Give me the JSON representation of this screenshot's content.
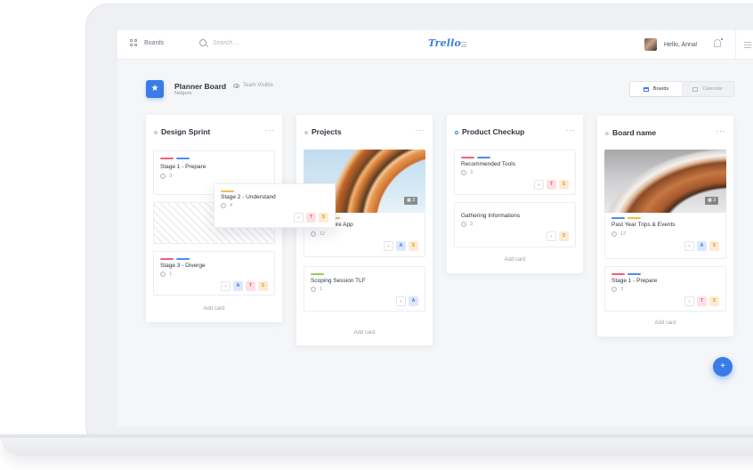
{
  "topbar": {
    "boards_label": "Boards",
    "search_placeholder": "Search ...",
    "logo": "Trello",
    "greeting": "Hello, Anna!"
  },
  "board": {
    "title": "Planner Board",
    "subtitle": "Netguru",
    "visibility": "Team Visible"
  },
  "view_toggle": {
    "boards": "Boards",
    "calendar": "Calendar"
  },
  "lists": [
    {
      "title": "Design Sprint",
      "cards": [
        {
          "title": "Stage 1 - Prepare",
          "count": "3"
        },
        {
          "title": "Stage 3 - Diverge",
          "count": "1",
          "members": [
            "+",
            "A",
            "T",
            "S"
          ]
        }
      ],
      "add_card": "Add card"
    },
    {
      "title": "Projects",
      "cards": [
        {
          "title": "Architecture App",
          "count": "12",
          "image_count": "3",
          "members": [
            "+",
            "A",
            "S"
          ]
        },
        {
          "title": "Scoping Session TLF",
          "count": "1",
          "members": [
            "+",
            "A"
          ]
        }
      ],
      "add_card": "Add card"
    },
    {
      "title": "Product Checkup",
      "cards": [
        {
          "title": "Recommended Tools",
          "count": "3",
          "members": [
            "+",
            "T",
            "S"
          ]
        },
        {
          "title": "Gathering Informations",
          "count": "3",
          "members": [
            "+",
            "S"
          ]
        }
      ],
      "add_card": "Add card"
    },
    {
      "title": "Board name",
      "cards": [
        {
          "title": "Past Year Trips & Events",
          "count": "12",
          "image_count": "3",
          "members": [
            "+",
            "A",
            "S"
          ]
        },
        {
          "title": "Stage 1 - Prepare",
          "count": "3",
          "members": [
            "+",
            "T",
            "S"
          ]
        }
      ],
      "add_card": "Add card"
    }
  ],
  "dragged_card": {
    "title": "Stage 2 - Understand",
    "count": "4",
    "members": [
      "+",
      "T",
      "S"
    ]
  },
  "fab": "+",
  "colors": {
    "accent": "#3a7be8",
    "label_red": "#f0607a",
    "label_blue": "#4a8cf0",
    "label_yellow": "#f5b94a",
    "label_green": "#8fcf5a"
  }
}
